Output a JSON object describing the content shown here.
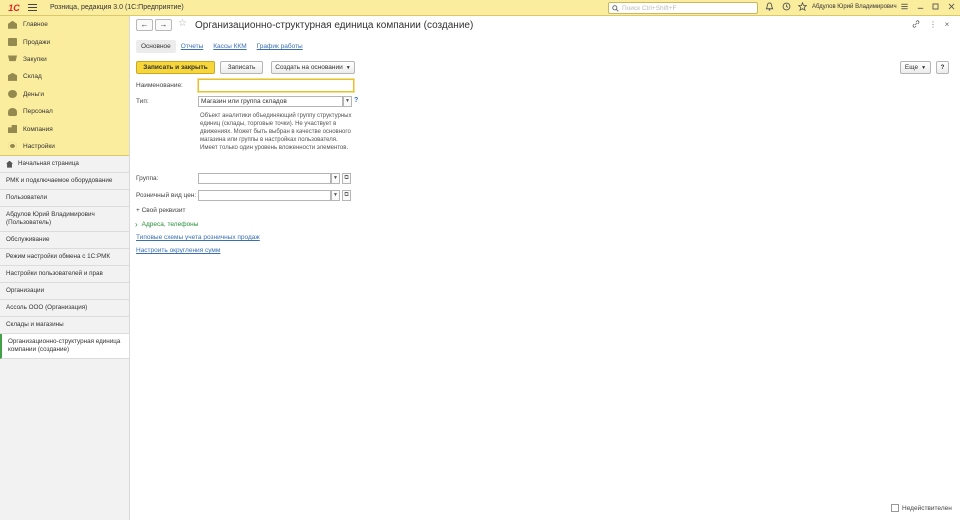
{
  "topbar": {
    "logo": "1С",
    "app_title": "Розница, редакция 3.0  (1С:Предприятие)",
    "search_placeholder": "Поиск Ctrl+Shift+F",
    "user_name": "Абдулов Юрий Владимирович"
  },
  "sidebar": {
    "sections": [
      {
        "label": "Главное",
        "icon": "home-icon"
      },
      {
        "label": "Продажи",
        "icon": "sales-icon"
      },
      {
        "label": "Закупки",
        "icon": "purchases-icon"
      },
      {
        "label": "Склад",
        "icon": "warehouse-icon"
      },
      {
        "label": "Деньги",
        "icon": "money-icon"
      },
      {
        "label": "Персонал",
        "icon": "personnel-icon"
      },
      {
        "label": "Компания",
        "icon": "company-icon"
      },
      {
        "label": "Настройки",
        "icon": "settings-icon"
      }
    ],
    "history": [
      {
        "label": "Начальная страница"
      },
      {
        "label": "РМК и подключаемое оборудование"
      },
      {
        "label": "Пользователи"
      },
      {
        "label": "Абдулов Юрий Владимирович (Пользователь)"
      },
      {
        "label": "Обслуживание"
      },
      {
        "label": "Режим настройки обмена с 1С:РМК"
      },
      {
        "label": "Настройки пользователей и прав"
      },
      {
        "label": "Организации"
      },
      {
        "label": "Ассоль ООО (Организация)"
      },
      {
        "label": "Склады и магазины"
      },
      {
        "label": "Организационно-структурная единица компании (создание)"
      }
    ]
  },
  "form": {
    "title": "Организационно-структурная единица компании (создание)",
    "tabs": [
      {
        "label": "Основное"
      },
      {
        "label": "Отчеты"
      },
      {
        "label": "Кассы ККМ"
      },
      {
        "label": "График работы"
      }
    ],
    "buttons": {
      "save_close": "Записать и закрыть",
      "save": "Записать",
      "create_based": "Создать на основании",
      "more": "Еще",
      "help": "?"
    },
    "fields": {
      "name_label": "Наименование:",
      "name_value": "",
      "type_label": "Тип:",
      "type_value": "Магазин или группа складов",
      "type_hint": "Объект аналитики объединяющий группу структурных единиц (склады, торговые точки). Не участвует в движениях. Может быть выбран в качестве основного магазина или группы в настройках пользователя. Имеет только один уровень вложенности элементов.",
      "group_label": "Группа:",
      "group_value": "",
      "price_label": "Розничный вид цен:",
      "price_value": ""
    },
    "custom_attr": "+ Свой реквизит",
    "addresses": "Адреса, телефоны",
    "links": {
      "schemes": "Типовые схемы учета розничных продаж",
      "rounding": "Настроить округления сумм"
    },
    "inactive_label": "Недействителен"
  },
  "colors": {
    "accent_yellow": "#fbed9e",
    "primary_button": "#f6d63a",
    "link_blue": "#3a6fb4",
    "green": "#2a8f39"
  }
}
